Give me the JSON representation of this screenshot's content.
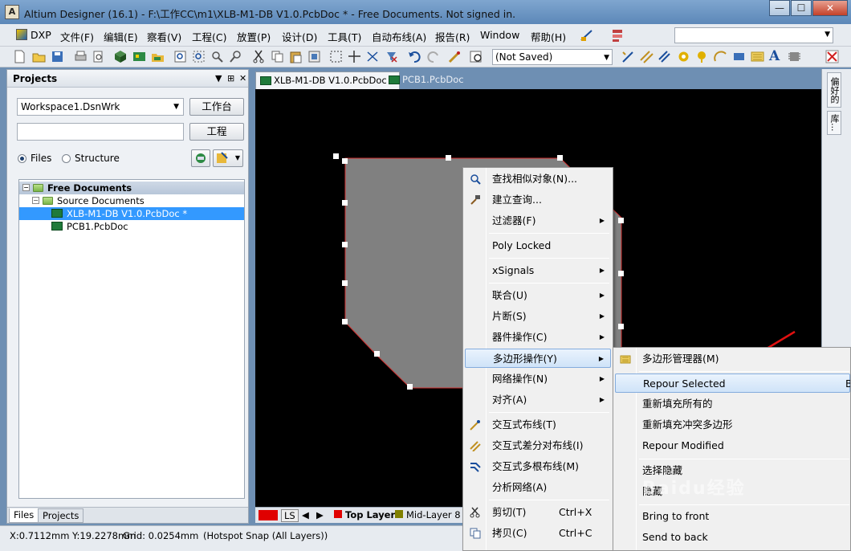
{
  "window": {
    "title": "Altium Designer (16.1) - F:\\工作CC\\m1\\XLB-M1-DB V1.0.PcbDoc * - Free Documents. Not signed in.",
    "app_icon_letter": "A",
    "min": "—",
    "max": "☐",
    "close": "✕"
  },
  "menubar": {
    "items": [
      "DXP",
      "文件(F)",
      "编辑(E)",
      "察看(V)",
      "工程(C)",
      "放置(P)",
      "设计(D)",
      "工具(T)",
      "自动布线(A)",
      "报告(R)",
      "Window",
      "帮助(H)"
    ]
  },
  "toolbar": {
    "variant_combo": "(Not Saved)"
  },
  "projects_panel": {
    "title": "Projects",
    "pin_glyphs": [
      "▼",
      "⊞",
      "✕"
    ],
    "workspace_select": "Workspace1.DsnWrk",
    "workspace_button": "工作台",
    "project_field": "",
    "project_button": "工程",
    "radio_files": "Files",
    "radio_structure": "Structure",
    "tree": {
      "root": "Free Documents",
      "group": "Source Documents",
      "docs": [
        "XLB-M1-DB V1.0.PcbDoc *",
        "PCB1.PcbDoc"
      ]
    },
    "bottom_tabs": [
      "Files",
      "Projects"
    ]
  },
  "doc_tabs": [
    "XLB-M1-DB V1.0.PcbDoc *",
    "PCB1.PcbDoc"
  ],
  "layer_bar": {
    "ls": "LS",
    "layers": [
      "Top Layer",
      "Mid-Layer 8"
    ],
    "colors": [
      "#e00000",
      "#e00000",
      "#808000"
    ]
  },
  "right_tabs": [
    "偏好的",
    "库..."
  ],
  "status": {
    "coords": "X:0.7112mm Y:19.2278mm",
    "grid": "Grid: 0.0254mm",
    "snap": "(Hotspot Snap (All Layers))"
  },
  "context_menu": {
    "items": [
      {
        "label": "查找相似对象(N)...",
        "icon": "find-similar-icon"
      },
      {
        "label": "建立查询...",
        "icon": "build-query-icon"
      },
      {
        "label": "过滤器(F)",
        "submenu": true
      },
      {
        "label": "Poly Locked"
      },
      {
        "label": "xSignals",
        "submenu": true
      },
      {
        "label": "联合(U)",
        "submenu": true
      },
      {
        "label": "片断(S)",
        "submenu": true
      },
      {
        "label": "器件操作(C)",
        "submenu": true
      },
      {
        "label": "多边形操作(Y)",
        "submenu": true,
        "highlighted": true
      },
      {
        "label": "网络操作(N)",
        "submenu": true
      },
      {
        "label": "对齐(A)",
        "submenu": true
      },
      {
        "label": "交互式布线(T)",
        "icon": "interactive-route-icon"
      },
      {
        "label": "交互式差分对布线(I)",
        "icon": "diff-pair-route-icon"
      },
      {
        "label": "交互式多根布线(M)",
        "icon": "multi-route-icon"
      },
      {
        "label": "分析网络(A)"
      },
      {
        "label": "剪切(T)",
        "shortcut": "Ctrl+X",
        "icon": "cut-icon"
      },
      {
        "label": "拷贝(C)",
        "shortcut": "Ctrl+C",
        "icon": "copy-icon"
      }
    ]
  },
  "polygon_submenu": {
    "items": [
      {
        "label": "多边形管理器(M)",
        "icon": "polygon-manager-icon"
      },
      {
        "label": "Repour Selected",
        "shortcut": "B",
        "highlighted": true
      },
      {
        "label": "重新填充所有的"
      },
      {
        "label": "重新填充冲突多边形"
      },
      {
        "label": "Repour Modified"
      },
      {
        "label": "选择隐藏"
      },
      {
        "label": "隐藏"
      },
      {
        "label": "Bring to front"
      },
      {
        "label": "Send to back"
      }
    ]
  },
  "colors": {
    "canvas": "#000000",
    "polygon_fill": "#808080",
    "polygon_outline": "#d03030",
    "annotation_arrow": "#e01010",
    "selection": "#3399ff"
  },
  "watermark": "Baidu经验"
}
